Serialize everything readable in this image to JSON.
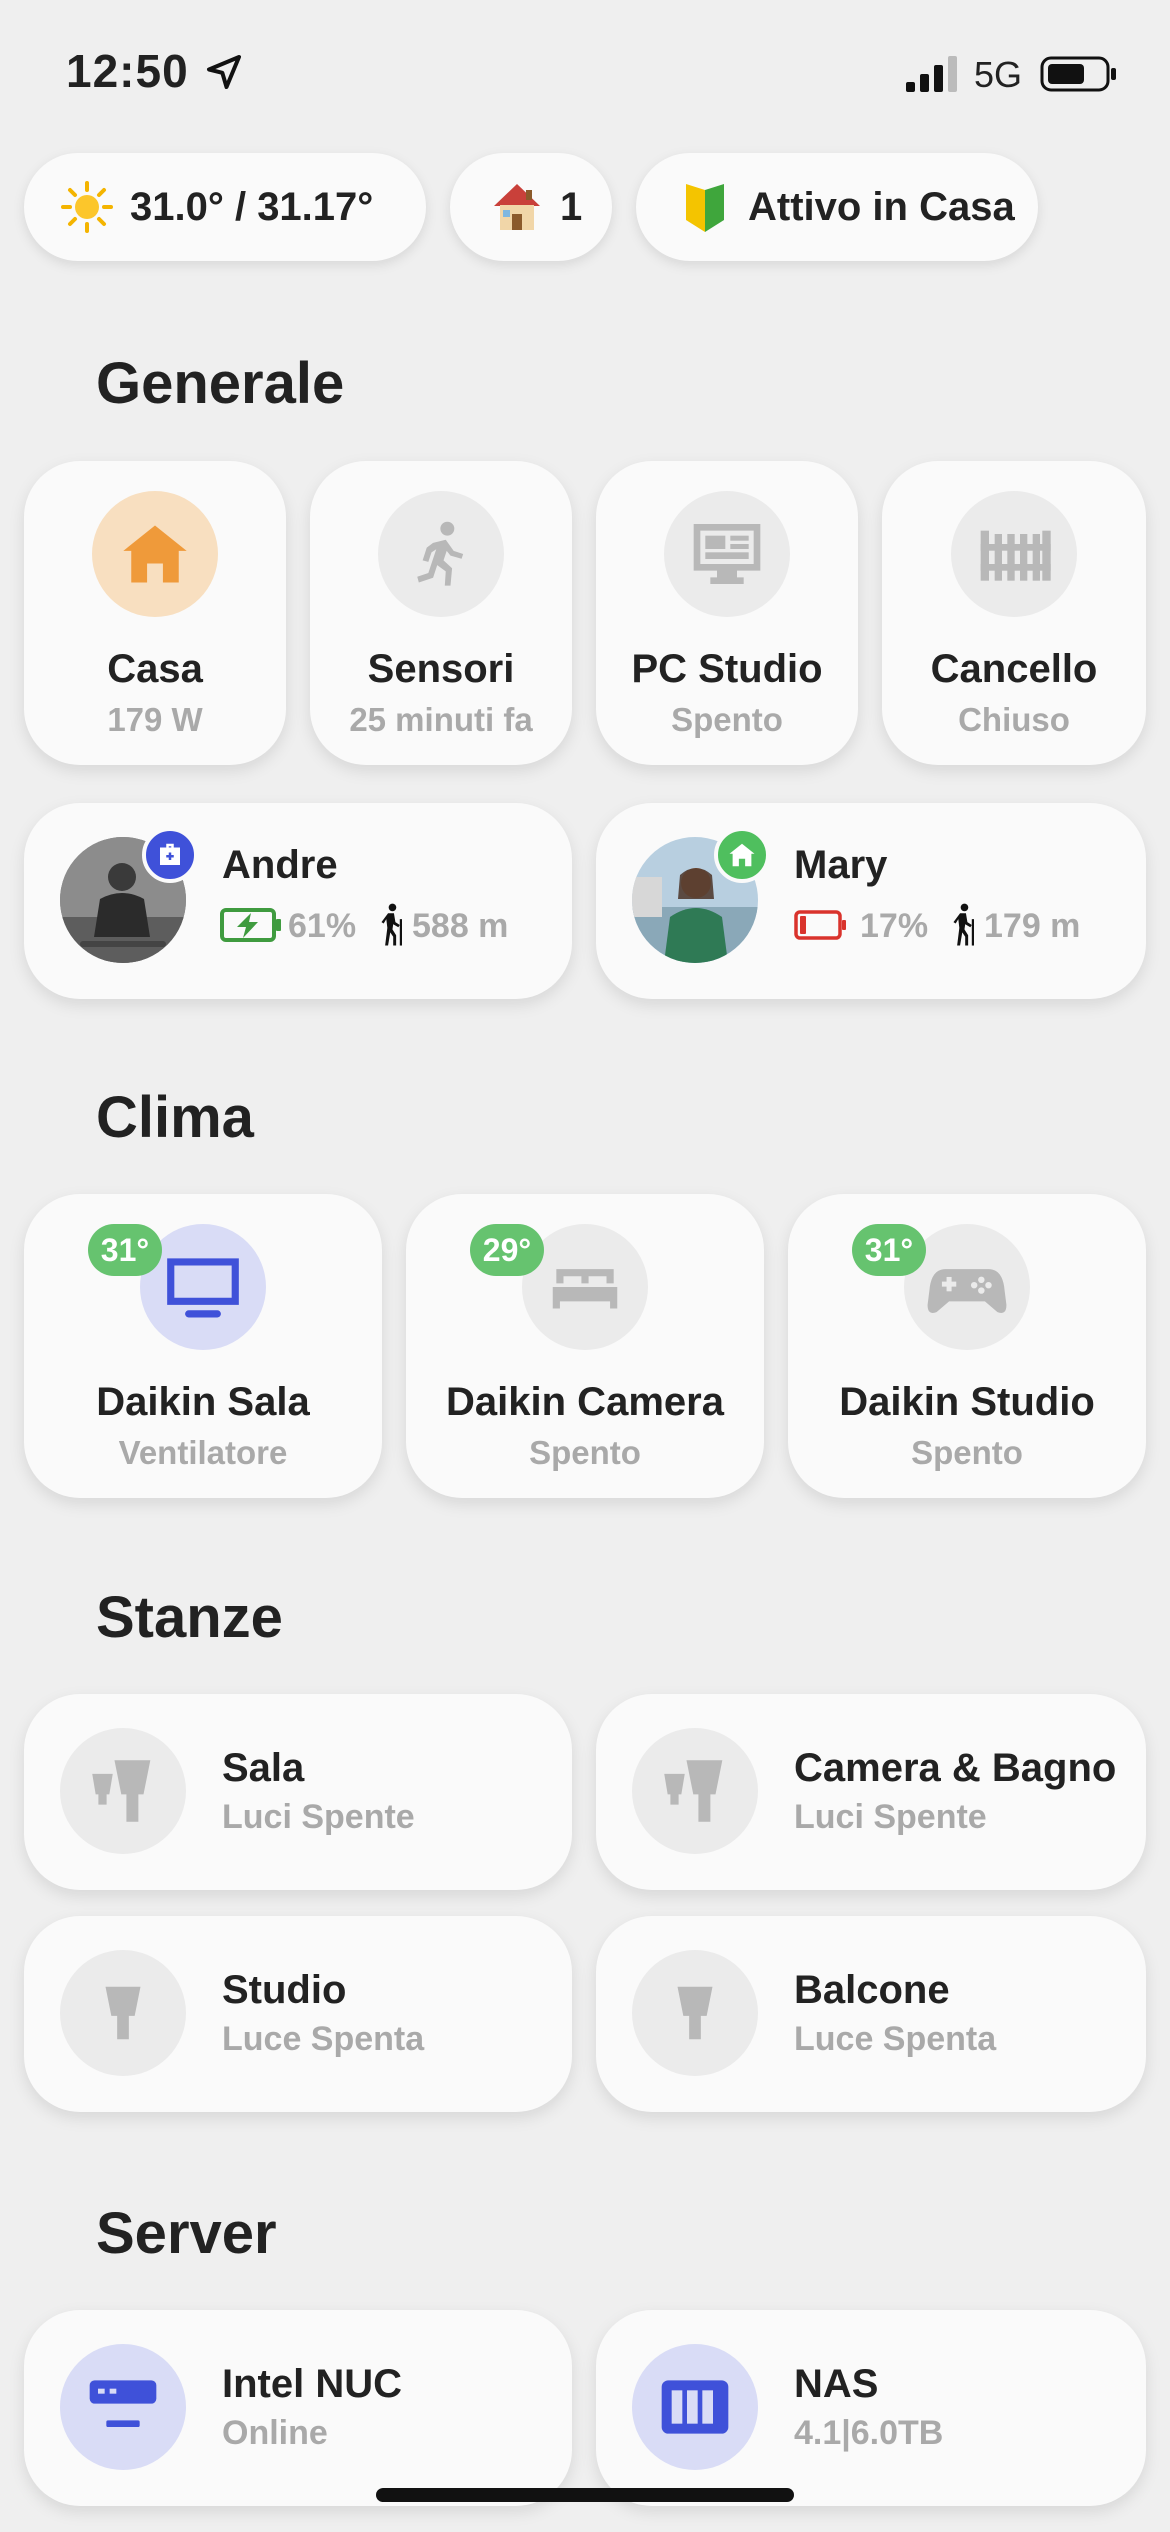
{
  "status_bar": {
    "time": "12:50",
    "network": "5G"
  },
  "chips": [
    {
      "icon": "sun-icon",
      "label": "31.0° / 31.17°"
    },
    {
      "icon": "house-icon",
      "label": "1"
    },
    {
      "icon": "beginner-badge-icon",
      "label": "Attivo in Casa"
    }
  ],
  "sections": {
    "generale": "Generale",
    "clima": "Clima",
    "stanze": "Stanze",
    "server": "Server"
  },
  "generale_tiles": [
    {
      "title": "Casa",
      "sub": "179 W",
      "icon": "home-icon"
    },
    {
      "title": "Sensori",
      "sub": "25 minuti fa",
      "icon": "running-person-icon"
    },
    {
      "title": "PC Studio",
      "sub": "Spento",
      "icon": "monitor-icon"
    },
    {
      "title": "Cancello",
      "sub": "Chiuso",
      "icon": "gate-icon"
    }
  ],
  "people": [
    {
      "name": "Andre",
      "badge_icon": "work-bag-icon",
      "battery": "61%",
      "distance": "588 m",
      "battery_color": "#3f9b3f",
      "badge_color": "#3f51d9"
    },
    {
      "name": "Mary",
      "badge_icon": "home-icon",
      "battery": "17%",
      "distance": "179 m",
      "battery_color": "#d9332c",
      "badge_color": "#4fbf5e"
    }
  ],
  "clima": [
    {
      "title": "Daikin Sala",
      "sub": "Ventilatore",
      "temp": "31°",
      "icon": "tv-icon"
    },
    {
      "title": "Daikin Camera",
      "sub": "Spento",
      "temp": "29°",
      "icon": "bed-icon"
    },
    {
      "title": "Daikin Studio",
      "sub": "Spento",
      "temp": "31°",
      "icon": "gamepad-icon"
    }
  ],
  "stanze": [
    {
      "title": "Sala",
      "sub": "Luci Spente",
      "icon": "bulbs-icon"
    },
    {
      "title": "Camera & Bagno",
      "sub": "Luci Spente",
      "icon": "bulbs-icon"
    },
    {
      "title": "Studio",
      "sub": "Luce Spenta",
      "icon": "bulb-icon"
    },
    {
      "title": "Balcone",
      "sub": "Luce Spenta",
      "icon": "bulb-icon"
    }
  ],
  "server": [
    {
      "title": "Intel NUC",
      "sub": "Online",
      "icon": "mini-pc-icon"
    },
    {
      "title": "NAS",
      "sub": "4.1|6.0TB",
      "icon": "nas-icon"
    }
  ],
  "colors": {
    "background": "#efefef",
    "card": "#fafafa",
    "accent_blue": "#3f51d9",
    "orange": "#ef9a3a",
    "green": "#66c36f",
    "muted_text": "#a9a9a9"
  }
}
